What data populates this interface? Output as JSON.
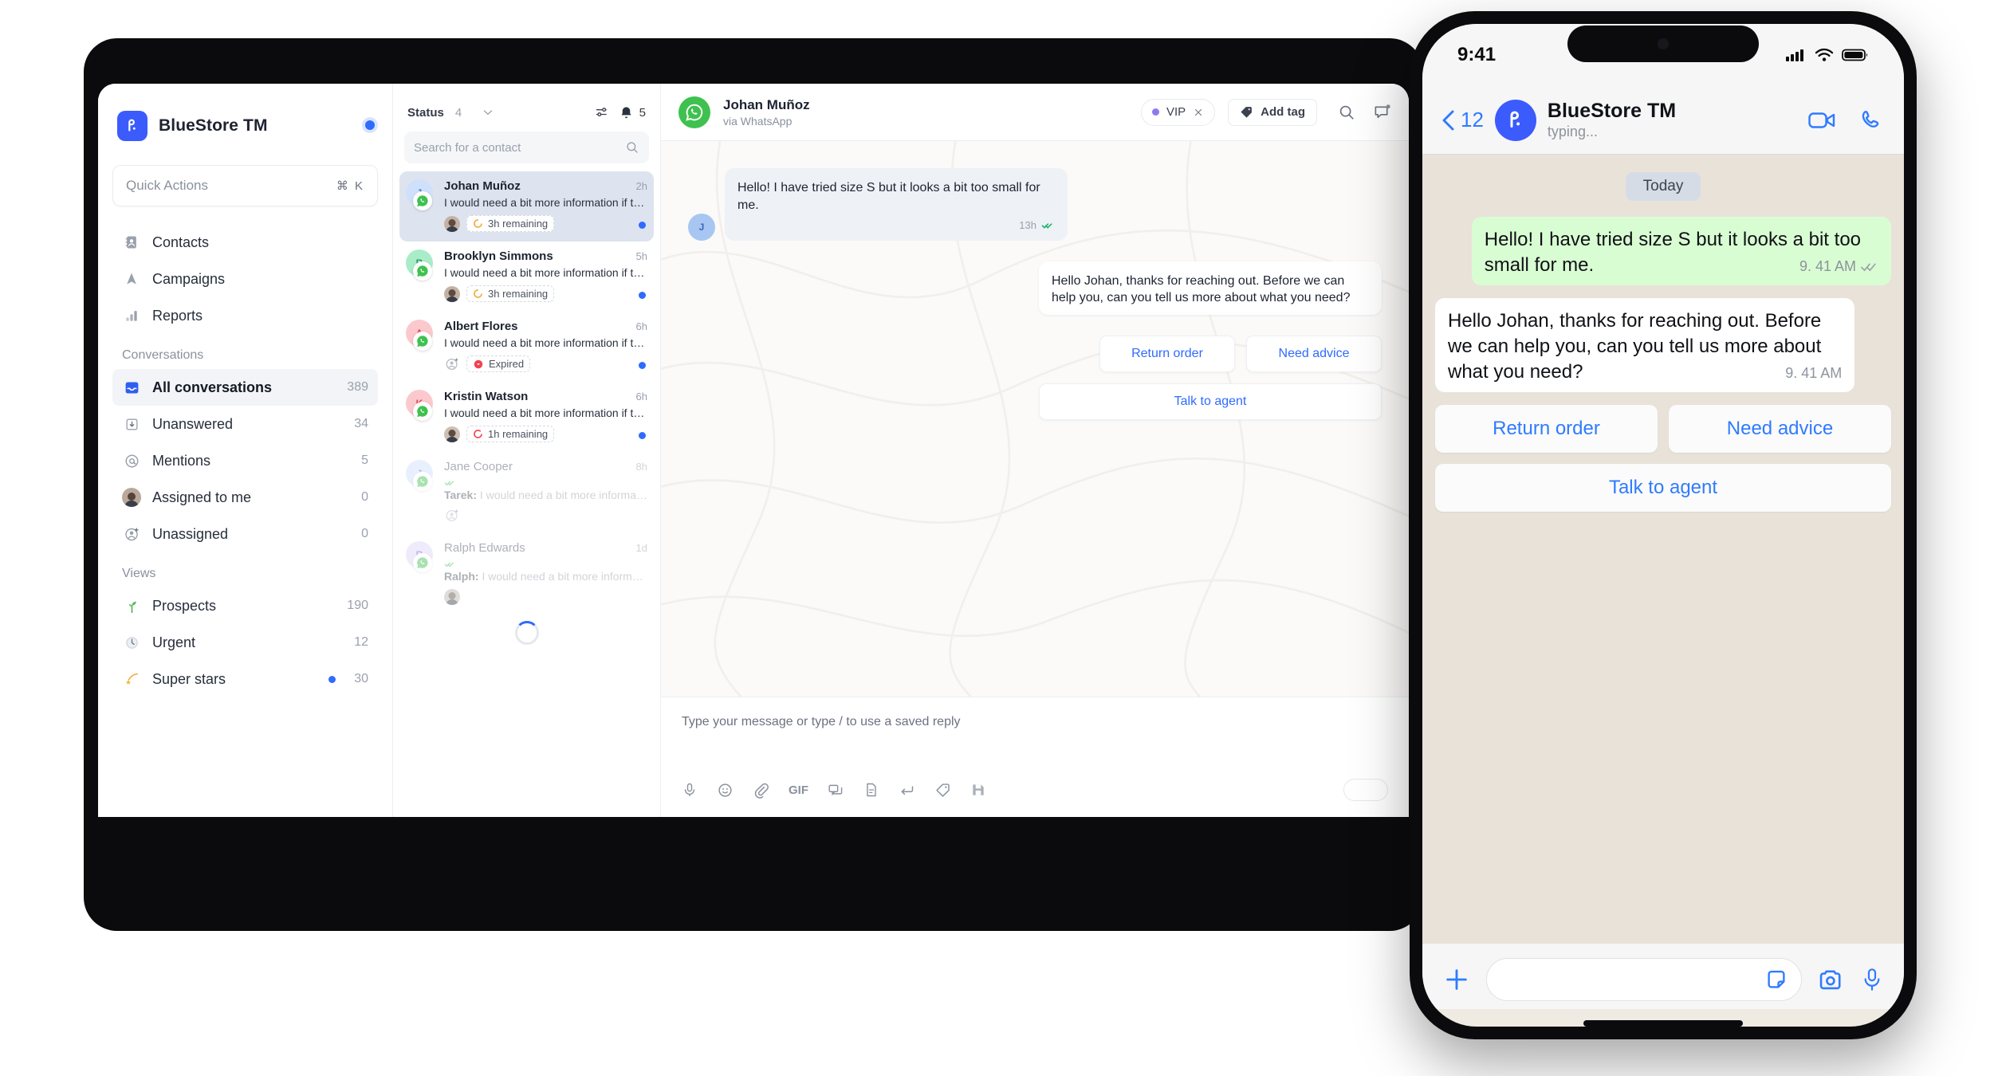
{
  "brand": {
    "name": "BlueStore TM",
    "logo_icon": "brand-logo-icon",
    "status_dot_color": "#2f6bff"
  },
  "quick_actions": {
    "placeholder": "Quick Actions",
    "shortcut": "⌘ K"
  },
  "sidebar": {
    "primary": [
      {
        "label": "Contacts",
        "icon": "contacts-book-icon"
      },
      {
        "label": "Campaigns",
        "icon": "campaigns-icon"
      },
      {
        "label": "Reports",
        "icon": "reports-bar-icon"
      }
    ],
    "conversations_label": "Conversations",
    "conversations": [
      {
        "label": "All conversations",
        "count": "389",
        "icon": "inbox-icon",
        "active": true
      },
      {
        "label": "Unanswered",
        "count": "34",
        "icon": "arrow-down-box-icon",
        "active": false
      },
      {
        "label": "Mentions",
        "count": "5",
        "icon": "at-mention-icon",
        "active": false
      },
      {
        "label": "Assigned to me",
        "count": "0",
        "icon": "user-avatar-icon",
        "active": false
      },
      {
        "label": "Unassigned",
        "count": "0",
        "icon": "user-add-icon",
        "active": false
      }
    ],
    "views_label": "Views",
    "views": [
      {
        "label": "Prospects",
        "count": "190",
        "icon": "seedling-icon",
        "dot": false
      },
      {
        "label": "Urgent",
        "count": "12",
        "icon": "clock-icon",
        "dot": false
      },
      {
        "label": "Super stars",
        "count": "30",
        "icon": "shooting-star-icon",
        "dot": true
      }
    ]
  },
  "conversation_list": {
    "status_label": "Status",
    "status_count": "4",
    "filter_icon": "sliders-icon",
    "bell_icon": "bell-icon",
    "bell_count": "5",
    "search_placeholder": "Search for a contact",
    "search_value": "",
    "search_icon": "search-icon",
    "items": [
      {
        "name": "Johan Muñoz",
        "time": "2h",
        "preview": "I would need a bit more information if that's…",
        "initial": "J",
        "avatar_bg": "#cfe0fb",
        "avatar_fg": "#4a7fd4",
        "sla": "3h remaining",
        "sla_type": "orange",
        "assignee": "avatar",
        "unread": true,
        "selected": true,
        "faded": false,
        "sender": ""
      },
      {
        "name": "Brooklyn Simmons",
        "time": "5h",
        "preview": "I would need a bit more information if that's…",
        "initial": "B",
        "avatar_bg": "#a9ecc8",
        "avatar_fg": "#239a63",
        "sla": "3h remaining",
        "sla_type": "orange",
        "assignee": "avatar",
        "unread": true,
        "selected": false,
        "faded": false,
        "sender": ""
      },
      {
        "name": "Albert Flores",
        "time": "6h",
        "preview": "I would need a bit more information if that's…",
        "initial": "A",
        "avatar_bg": "#fbc9cd",
        "avatar_fg": "#e0454f",
        "sla": "Expired",
        "sla_type": "red",
        "assignee": "unassigned",
        "unread": true,
        "selected": false,
        "faded": false,
        "sender": ""
      },
      {
        "name": "Kristin Watson",
        "time": "6h",
        "preview": "I would need a bit more information if that's…",
        "initial": "K",
        "avatar_bg": "#fbc9cd",
        "avatar_fg": "#e0454f",
        "sla": "1h remaining",
        "sla_type": "red",
        "assignee": "avatar",
        "unread": true,
        "selected": false,
        "faded": false,
        "sender": ""
      },
      {
        "name": "Jane Cooper",
        "time": "8h",
        "preview": "I would need a bit more information…",
        "initial": "J",
        "avatar_bg": "#cfe0fb",
        "avatar_fg": "#4a7fd4",
        "sla": "",
        "sla_type": "none",
        "assignee": "unassigned",
        "unread": false,
        "selected": false,
        "faded": true,
        "sender": "Tarek:"
      },
      {
        "name": "Ralph Edwards",
        "time": "1d",
        "preview": "I would need a bit more information…",
        "initial": "R",
        "avatar_bg": "#dcd5f8",
        "avatar_fg": "#6f5fd0",
        "sla": "",
        "sla_type": "none",
        "assignee": "avatar",
        "unread": false,
        "selected": false,
        "faded": true,
        "sender": "Ralph:"
      }
    ]
  },
  "chat": {
    "contact_name": "Johan Muñoz",
    "channel": "via WhatsApp",
    "channel_icon": "whatsapp-icon",
    "tags": [
      {
        "label": "VIP",
        "dot_color": "#8b7bf0",
        "removable": true
      }
    ],
    "add_tag_label": "Add tag",
    "add_tag_icon": "tag-icon",
    "header_icons": [
      "search-icon",
      "note-bubble-icon"
    ],
    "messages": [
      {
        "direction": "in",
        "text": "Hello! I have tried size S but it looks a bit too small for me.",
        "time": "13h",
        "receipt": "double-check-icon",
        "avatar_initial": "J"
      },
      {
        "direction": "out",
        "text": "Hello Johan, thanks for reaching out. Before we can help you, can you tell us more about what you need?",
        "time": "",
        "receipt": "",
        "avatar_initial": ""
      }
    ],
    "quick_replies": [
      "Return order",
      "Need advice",
      "Talk to agent"
    ],
    "composer": {
      "placeholder": "Type your message or type / to use a saved reply",
      "tools": [
        "microphone-icon",
        "emoji-icon",
        "attachment-icon",
        "gif-icon",
        "canned-reply-icon",
        "document-icon",
        "enter-key-icon",
        "tag-icon",
        "save-icon"
      ]
    }
  },
  "phone": {
    "status_bar": {
      "time": "9:41",
      "signal_icon": "cellular-signal-icon",
      "wifi_icon": "wifi-icon",
      "battery_icon": "battery-icon"
    },
    "header": {
      "back_count": "12",
      "back_icon": "chevron-left-icon",
      "title": "BlueStore TM",
      "subtitle": "typing...",
      "avatar_icon": "brand-logo-icon",
      "video_icon": "video-camera-icon",
      "call_icon": "phone-call-icon"
    },
    "day_divider": "Today",
    "messages": [
      {
        "direction": "out",
        "text": "Hello! I have tried size S but it looks a bit too small for me.",
        "time": "9. 41 AM",
        "receipt": "double-check-icon"
      },
      {
        "direction": "in",
        "text": "Hello Johan, thanks for reaching out. Before we can help you, can you tell us more about what you need?",
        "time": "9. 41 AM",
        "receipt": ""
      }
    ],
    "quick_replies": [
      "Return order",
      "Need advice",
      "Talk to agent"
    ],
    "input_bar": {
      "plus_icon": "plus-icon",
      "placeholder": "",
      "sticker_icon": "sticker-icon",
      "camera_icon": "camera-icon",
      "mic_icon": "microphone-icon"
    }
  }
}
